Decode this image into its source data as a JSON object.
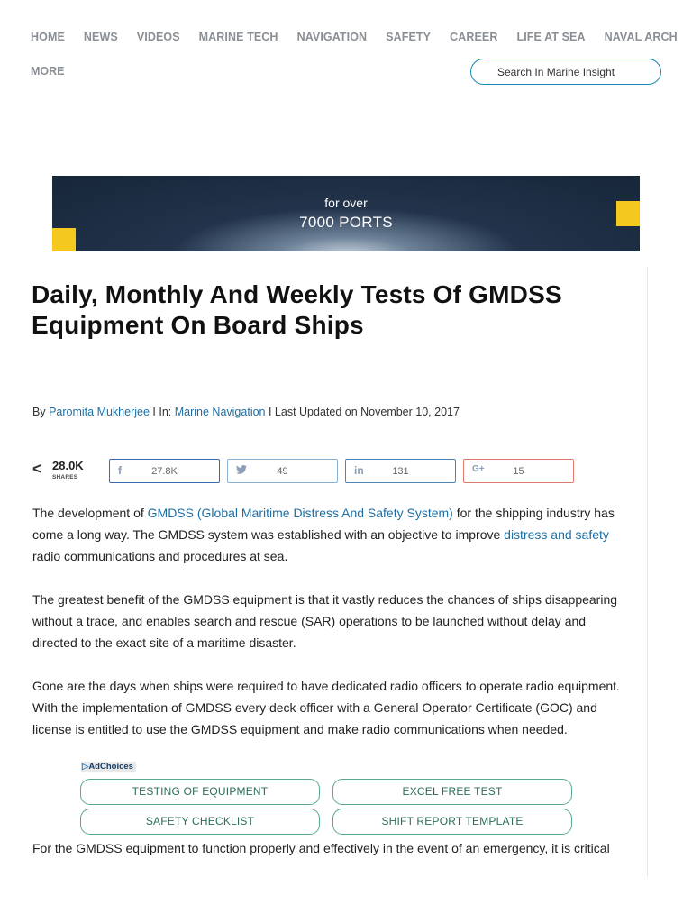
{
  "nav": {
    "items": [
      "HOME",
      "NEWS",
      "VIDEOS",
      "MARINE TECH",
      "NAVIGATION",
      "SAFETY",
      "CAREER",
      "LIFE AT SEA",
      "NAVAL ARCH"
    ],
    "more": "MORE",
    "search_placeholder": "Search In Marine Insight"
  },
  "banner": {
    "line1": "for over",
    "line2": "7000 PORTS"
  },
  "article": {
    "title": "Daily, Monthly And Weekly Tests Of GMDSS Equipment On Board Ships",
    "meta": {
      "by": "By",
      "author": "Paromita Mukherjee",
      "in_sep": "I In:",
      "category": "Marine Navigation",
      "updated": "I Last Updated on November 10, 2017"
    },
    "share": {
      "total": "28.0K",
      "total_label": "SHARES",
      "facebook": "27.8K",
      "twitter": "49",
      "linkedin": "131",
      "googleplus": "15"
    },
    "p1": {
      "pre": "The development of ",
      "link1": "GMDSS (Global Maritime Distress And Safety System)",
      "mid": " for the shipping industry has come a long way. The GMDSS system was established with an objective to improve ",
      "link2": "distress and safety",
      "post": " radio communications and procedures at sea."
    },
    "p2": "The greatest benefit of the GMDSS equipment is that it vastly reduces the chances of ships disappearing without a trace, and enables search and rescue (SAR) operations to be launched without delay and directed to the exact site of a maritime disaster.",
    "p3": "Gone are the days when ships were required to have dedicated radio officers to operate radio equipment. With the implementation of GMDSS every deck officer with a General Operator Certificate (GOC) and license is entitled to use the GMDSS equipment and make radio communications when needed.",
    "p4": "For the GMDSS equipment to function properly and effectively in the event of an emergency, it is critical"
  },
  "ads": {
    "adchoices": "AdChoices",
    "buttons": [
      "TESTING OF EQUIPMENT",
      "EXCEL FREE TEST",
      "SAFETY CHECKLIST",
      "SHIFT REPORT TEMPLATE"
    ]
  },
  "icons": {
    "share": "share-icon",
    "facebook": "facebook-icon",
    "twitter": "twitter-icon",
    "linkedin": "linkedin-icon",
    "googleplus": "google-plus-icon",
    "adchoices": "adchoices-icon"
  },
  "colors": {
    "link": "#1d6fa5",
    "nav": "#8a8f95",
    "search_border": "#1a89b8",
    "banner_accent": "#f5c81e",
    "ad_border": "#5aa88d"
  }
}
